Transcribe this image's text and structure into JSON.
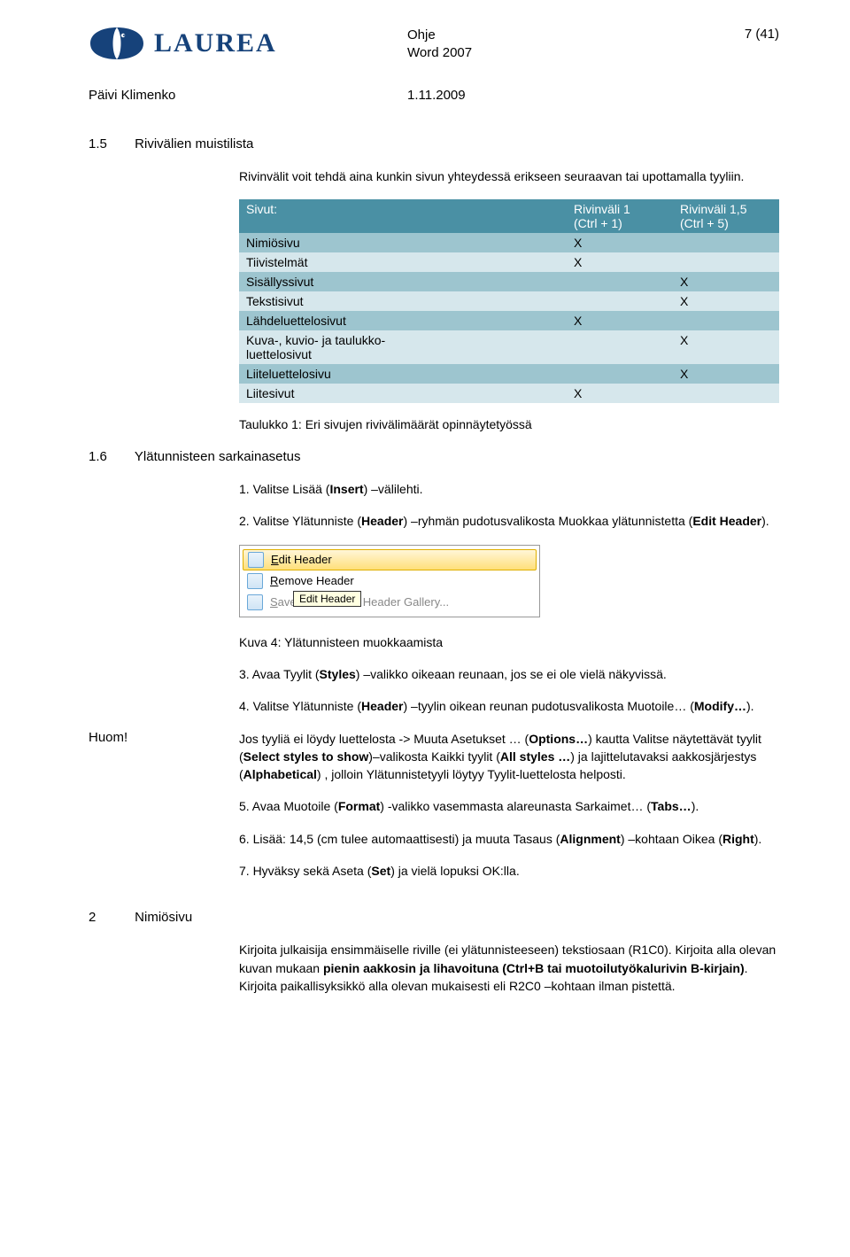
{
  "header": {
    "logo_text": "LAUREA",
    "doc_type": "Ohje",
    "doc_subject": "Word 2007",
    "page_label": "7 (41)",
    "author": "Päivi Klimenko",
    "date": "1.11.2009"
  },
  "sections": {
    "s15": {
      "num": "1.5",
      "title": "Rivivälien muistilista"
    },
    "s16": {
      "num": "1.6",
      "title": "Ylätunnisteen sarkainasetus"
    },
    "s2": {
      "num": "2",
      "title": "Nimiösivu"
    }
  },
  "intro_15": "Rivinvälit voit tehdä aina kunkin sivun yhteydessä erikseen seuraavan tai upottamalla tyyliin.",
  "table": {
    "headers": [
      "Sivut:",
      "Rivinväli 1\n(Ctrl + 1)",
      "Rivinväli 1,5\n(Ctrl + 5)"
    ],
    "rows": [
      {
        "label": "Nimiösivu",
        "c1": "X",
        "c2": ""
      },
      {
        "label": "Tiivistelmät",
        "c1": "X",
        "c2": ""
      },
      {
        "label": "Sisällyssivut",
        "c1": "",
        "c2": "X"
      },
      {
        "label": "Tekstisivut",
        "c1": "",
        "c2": "X"
      },
      {
        "label": "Lähdeluettelosivut",
        "c1": "X",
        "c2": ""
      },
      {
        "label": "Kuva-, kuvio- ja taulukko-\nluettelosivut",
        "c1": "",
        "c2": "X"
      },
      {
        "label": "Liiteluettelosivu",
        "c1": "",
        "c2": "X"
      },
      {
        "label": "Liitesivut",
        "c1": "X",
        "c2": ""
      }
    ],
    "caption": "Taulukko 1: Eri sivujen rivivälimäärät opinnäytetyössä"
  },
  "steps_16": {
    "step1": "1. Valitse Lisää (Insert) –välilehti.",
    "step2": "2. Valitse Ylätunniste (Header) –ryhmän pudotusvalikosta Muokkaa ylätunnistetta (Edit Header).",
    "caption4": "Kuva 4: Ylätunnisteen muokkaamista",
    "step3": "3. Avaa Tyylit (Styles) –valikko oikeaan reunaan, jos se ei ole vielä näkyvissä.",
    "step4": "4. Valitse Ylätunniste (Header) –tyylin oikean reunan pudotusvalikosta Muotoile… (Modify…)."
  },
  "menu": {
    "edit": "Edit Header",
    "remove": "Remove Header",
    "save": "Save Selection to Header Gallery...",
    "tooltip": "Edit Header"
  },
  "huom": {
    "label": "Huom!",
    "text": "Jos tyyliä ei löydy luettelosta -> Muuta Asetukset … (Options…) kautta Valitse näytettävät tyylit (Select styles to show)–valikosta Kaikki tyylit (All styles …) ja lajittelutavaksi aakkosjärjestys (Alphabetical) , jolloin Ylätunnistetyyli löytyy Tyylit-luettelosta helposti."
  },
  "steps_after": {
    "step5": "5. Avaa Muotoile (Format) -valikko vasemmasta alareunasta Sarkaimet… (Tabs…).",
    "step6": "6. Lisää: 14,5 (cm tulee automaattisesti) ja muuta Tasaus (Alignment) –kohtaan Oikea (Right).",
    "step7": "7. Hyväksy sekä Aseta (Set) ja vielä lopuksi OK:lla."
  },
  "nimi_text": "Kirjoita julkaisija ensimmäiselle riville (ei ylätunnisteeseen) tekstiosaan (R1C0). Kirjoita alla olevan kuvan mukaan pienin aakkosin ja lihavoituna (Ctrl+B tai muotoilutyökalurivin B-kirjain). Kirjoita paikallisyksikkö alla olevan mukaisesti eli R2C0 –kohtaan ilman pistettä."
}
